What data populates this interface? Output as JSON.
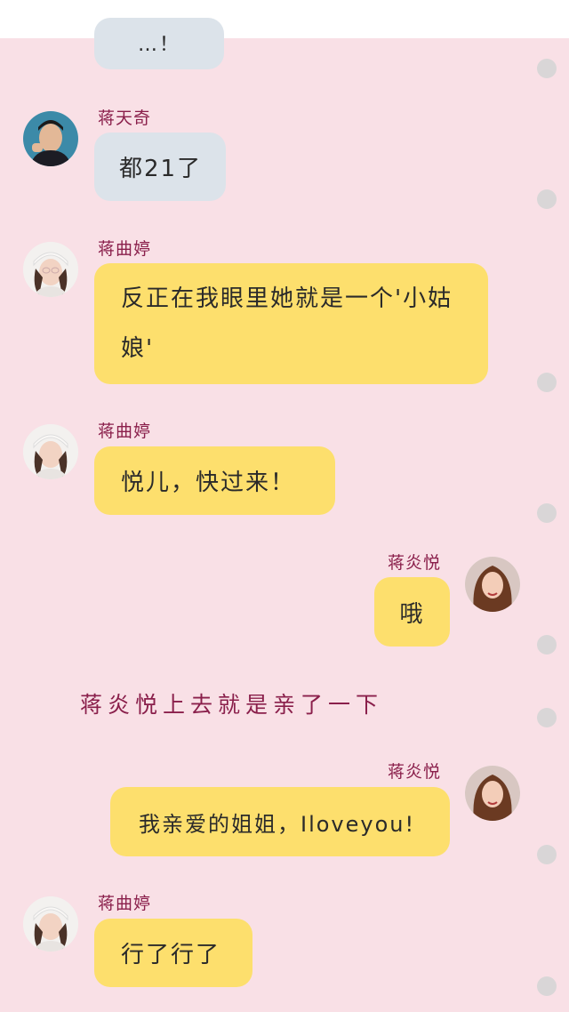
{
  "messages": [
    {
      "sender": "",
      "text": "…！",
      "style": "blue",
      "side": "left"
    },
    {
      "sender": "蒋天奇",
      "text": "都21了",
      "style": "blue",
      "side": "left"
    },
    {
      "sender": "蒋曲婷",
      "text": "反正在我眼里她就是一个'小姑娘'",
      "style": "yellow",
      "side": "left"
    },
    {
      "sender": "蒋曲婷",
      "text": "悦儿，快过来！",
      "style": "yellow",
      "side": "left"
    },
    {
      "sender": "蒋炎悦",
      "text": "哦",
      "style": "yellow",
      "side": "right"
    },
    {
      "sender": "蒋炎悦",
      "text": "我亲爱的姐姐，Iloveyou!",
      "style": "yellow",
      "side": "right"
    },
    {
      "sender": "蒋曲婷",
      "text": "行了行了",
      "style": "yellow",
      "side": "left"
    }
  ],
  "narration": "蒋炎悦上去就是亲了一下",
  "colors": {
    "background": "#f9e0e6",
    "bubble_blue": "#dce3ea",
    "bubble_yellow": "#fddf6d",
    "name_text": "#8a1f4b"
  }
}
